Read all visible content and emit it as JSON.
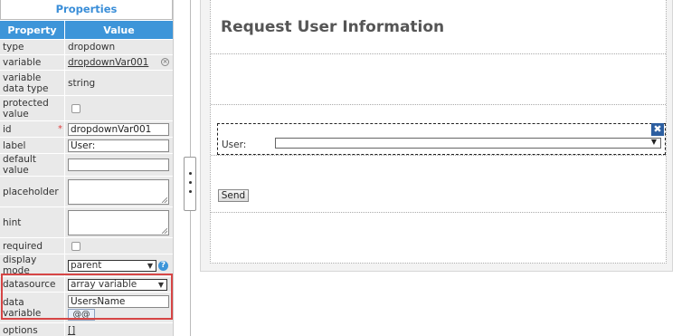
{
  "properties": {
    "title": "Properties",
    "headers": {
      "property": "Property",
      "value": "Value"
    },
    "rows": {
      "type": {
        "label": "type",
        "value": "dropdown"
      },
      "variable": {
        "label": "variable",
        "value": "dropdownVar001"
      },
      "data_type": {
        "label": "variable data type",
        "value": "string"
      },
      "protected": {
        "label": "protected value"
      },
      "id": {
        "label": "id",
        "value": "dropdownVar001",
        "required_mark": "*"
      },
      "label": {
        "label": "label",
        "value": "User:"
      },
      "default": {
        "label": "default value",
        "value": ""
      },
      "placeholder": {
        "label": "placeholder",
        "value": ""
      },
      "hint": {
        "label": "hint",
        "value": ""
      },
      "required": {
        "label": "required"
      },
      "display_mode": {
        "label": "display mode",
        "value": "parent",
        "help": "?"
      },
      "datasource": {
        "label": "datasource",
        "value": "array variable"
      },
      "data_variable": {
        "label": "data variable",
        "value": "UsersName",
        "button": "@@"
      },
      "options": {
        "label": "options",
        "value": "[]"
      }
    }
  },
  "preview": {
    "title": "Request User Information",
    "field_label": "User:",
    "send_label": "Send",
    "delete_icon": "✖"
  },
  "icons": {
    "dropdown": "▼",
    "clear": "×"
  },
  "colors": {
    "accent": "#3d95d9",
    "highlight": "#d64545",
    "delete": "#2c5ea0"
  }
}
